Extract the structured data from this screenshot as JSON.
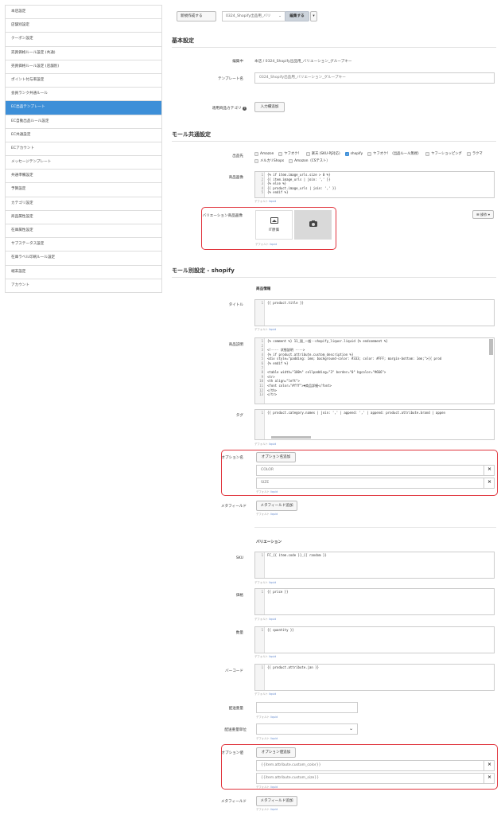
{
  "sidebar": {
    "items": [
      {
        "label": "本店設定",
        "active": false
      },
      {
        "label": "店舗別設定",
        "active": false
      },
      {
        "label": "クーポン設定",
        "active": false
      },
      {
        "label": "売買価格ルール設定 (共通)",
        "active": false
      },
      {
        "label": "売買価格ルール設定 (店舗別)",
        "active": false
      },
      {
        "label": "ポイント付与率設定",
        "active": false
      },
      {
        "label": "会員ランク共通ルール",
        "active": false
      },
      {
        "label": "EC出品テンプレート",
        "active": true
      },
      {
        "label": "EC自動出品ルール設定",
        "active": false
      },
      {
        "label": "EC共通設定",
        "active": false
      },
      {
        "label": "ECアカウント",
        "active": false
      },
      {
        "label": "メッセージテンプレート",
        "active": false
      },
      {
        "label": "共通準備設定",
        "active": false
      },
      {
        "label": "予算設定",
        "active": false
      },
      {
        "label": "カテゴリ設定",
        "active": false
      },
      {
        "label": "商品属性設定",
        "active": false
      },
      {
        "label": "在庫属性設定",
        "active": false
      },
      {
        "label": "サブステータス設定",
        "active": false
      },
      {
        "label": "在庫ラベル印刷ルール設定",
        "active": false
      },
      {
        "label": "端末設定",
        "active": false
      },
      {
        "label": "アカウント",
        "active": false
      }
    ]
  },
  "toolbar": {
    "new_label": "新規作成する",
    "template_select": "0324_Shopify出品用_バリ",
    "edit_label": "編集する",
    "more_caret": "▾"
  },
  "basic": {
    "heading": "基本設定",
    "editing_label": "編集中",
    "editing_value": "本店 / 0324_Shopify出品用_バリエーション_グループキー",
    "template_name_label": "テンプレート名",
    "template_name_value": "0324_Shopify出品用_バリエーション_グループキー",
    "category_label": "適用商品カテゴリ",
    "category_button": "入力欄追加"
  },
  "mall_common": {
    "heading": "モール共通設定",
    "destination_label": "出品先",
    "destinations": [
      {
        "label": "Amazon",
        "checked": false
      },
      {
        "label": "ヤフオク！",
        "checked": false
      },
      {
        "label": "楽天 (SKU-PJ対応)",
        "checked": false
      },
      {
        "label": "shopify",
        "checked": true
      },
      {
        "label": "ヤフオク！（出品ルール無視）",
        "checked": false
      },
      {
        "label": "ヤフーショッピング",
        "checked": false
      },
      {
        "label": "ラクマ",
        "checked": false
      },
      {
        "label": "メルカリShops",
        "checked": false
      },
      {
        "label": "Amazon（CSテスト）",
        "checked": false
      }
    ],
    "image_label": "商品画像",
    "image_code": [
      "{% if item.image_urls.size > 0 %}",
      "{{ item.image_urls | join: ',' }}",
      "{% else %}",
      "{{ product.image_urls | join: ',' }}",
      "{% endif %}"
    ],
    "default_prefix": "デフォルト",
    "liquid": "liquid",
    "variation_image_label": "バリエーション商品画像",
    "it_label": "IT原価",
    "ops_button": "操作 ▾"
  },
  "shopify": {
    "heading": "モール別設定 - shopify",
    "product_info": "商品情報",
    "title_label": "タイトル",
    "title_code": [
      "{{ product.title }}"
    ],
    "desc_label": "商品説明",
    "desc_code": [
      "{% comment %} 11_過_一般--shopify_liquor.liquid {% endcomment %}",
      "",
      "<!---- 状態説明 ---->",
      "{% if product.attribute.custom_description %}",
      "<div style=\"padding: 1em; background-color: #333; color: #FFF; margin-bottom: 1em;\">{{ prod",
      "{% endif %}",
      "",
      "<table width=\"100%\" cellpadding=\"3\" border=\"0\" bgcolor=\"#666\">",
      "    <tr>",
      "        <th align=\"left\">",
      "            <font color=\"#fff\">▼商品詳細</font>",
      "        </th>",
      "    </tr>"
    ],
    "tag_label": "タグ",
    "tag_code": [
      "{{ product.category.names | join: ',' | append: ',' | append: product.attribute.brand | appen"
    ],
    "option_name_label": "オプション名",
    "option_name_button": "オプション名追加",
    "option_names": [
      "COLOR",
      "SIZE"
    ],
    "metafield_label": "メタフィールド",
    "metafield_button": "メタフィールド追加",
    "variation_heading": "バリエーション",
    "sku_label": "SKU",
    "sku_code": [
      "FC_{{ item.code }}_{{ random }}"
    ],
    "price_label": "価格",
    "price_code": [
      "{{ price }}"
    ],
    "qty_label": "数量",
    "qty_code": [
      "{{ quantity }}"
    ],
    "barcode_label": "バーコード",
    "barcode_code": [
      "{{ product.attribute.jan }}"
    ],
    "weight_label": "配送重量",
    "weight_unit_label": "配送重量単位",
    "option_value_label": "オプション値",
    "option_value_button": "オプション値追加",
    "option_values": [
      "{{item.attribute.custom_color}}",
      "{{item.attribute.custom_size}}"
    ],
    "metafield2_label": "メタフィールド",
    "metafield2_button": "メタフィールド追加",
    "close_glyph": "×",
    "help_glyph": "?",
    "chevron_glyph": "⌄"
  },
  "colors": {
    "accent": "#3d8fd8",
    "highlight_border": "#e0333c"
  }
}
